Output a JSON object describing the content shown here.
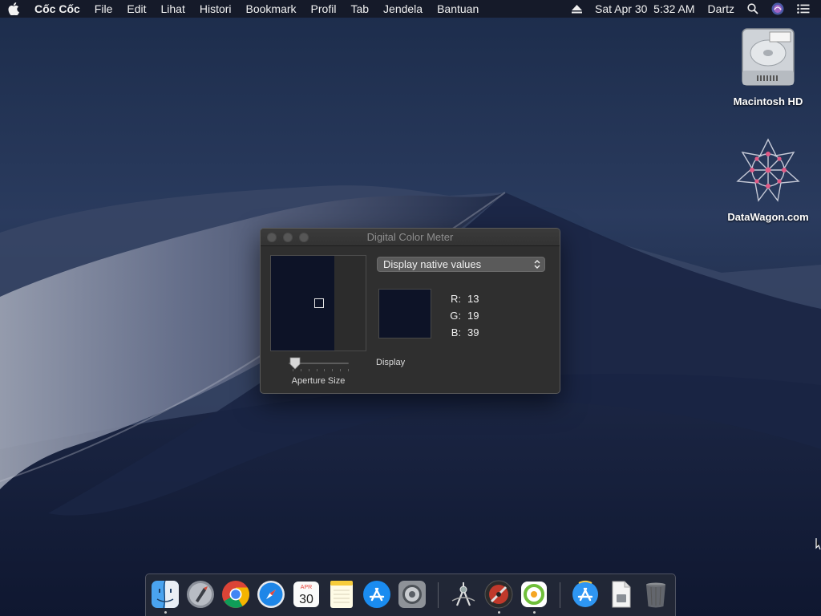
{
  "menubar": {
    "apple_icon": "apple-icon",
    "app_name": "Cốc Cốc",
    "items": [
      "File",
      "Edit",
      "Lihat",
      "Histori",
      "Bookmark",
      "Profil",
      "Tab",
      "Jendela",
      "Bantuan"
    ],
    "clock": "Sat Apr 30  5:32 AM",
    "user": "Dartz",
    "status_icons": [
      "eject-icon",
      "search-icon",
      "siri-icon",
      "control-center-icon"
    ]
  },
  "desktop": {
    "icons": [
      {
        "label": "Macintosh HD",
        "icon": "hard-drive-icon"
      },
      {
        "label": "DataWagon.com",
        "icon": "datawagon-logo-icon"
      }
    ]
  },
  "window": {
    "title": "Digital Color Meter",
    "dropdown_value": "Display native values",
    "color": {
      "r_label": "R:",
      "r": "13",
      "g_label": "G:",
      "g": "19",
      "b_label": "B:",
      "b": "39",
      "swatch_hex": "#0d1327"
    },
    "aperture_label": "Aperture Size",
    "display_label": "Display"
  },
  "dock": {
    "apps": [
      {
        "name": "finder-icon",
        "running": true
      },
      {
        "name": "launchpad-icon",
        "running": false
      },
      {
        "name": "chrome-icon",
        "running": false
      },
      {
        "name": "safari-icon",
        "running": false
      },
      {
        "name": "calendar-icon",
        "running": false,
        "month": "APR",
        "day": "30"
      },
      {
        "name": "notes-icon",
        "running": false
      },
      {
        "name": "app-store-icon",
        "running": false
      },
      {
        "name": "system-preferences-icon",
        "running": false
      },
      {
        "name": "digital-color-meter-icon",
        "running": false
      },
      {
        "name": "coccoc-browser-icon",
        "running": true
      },
      {
        "name": "coccoc-green-icon",
        "running": true
      },
      {
        "name": "app-store-downloads-icon",
        "running": false
      },
      {
        "name": "document-icon",
        "running": false
      },
      {
        "name": "trash-icon",
        "running": false
      }
    ]
  }
}
